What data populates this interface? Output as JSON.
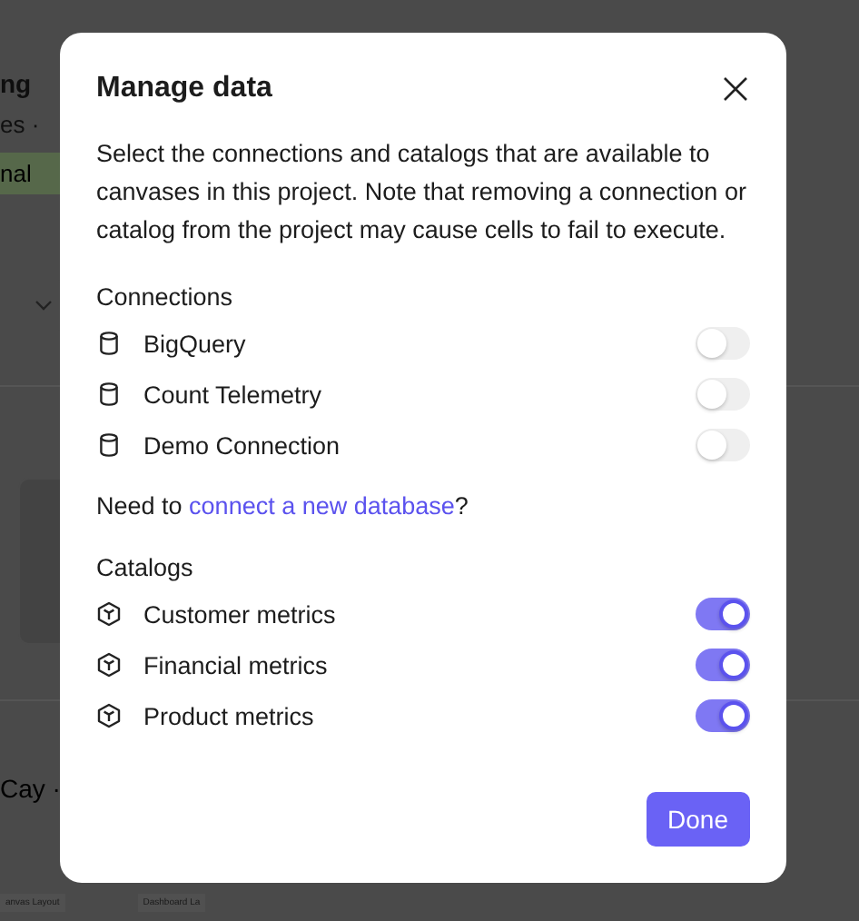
{
  "background": {
    "title": "ng",
    "subtitle": "es ·",
    "badge": "nal",
    "byline": "Cay ·",
    "thumbnails": [
      "anvas Layout",
      "Dashboard La"
    ]
  },
  "dialog": {
    "title": "Manage data",
    "description": "Select the connections and catalogs that are available to canvases in this project. Note that removing a connection or catalog from the project may cause cells to fail to execute.",
    "sections": [
      {
        "heading": "Connections",
        "kind": "connection",
        "items": [
          {
            "label": "BigQuery",
            "on": false
          },
          {
            "label": "Count Telemetry",
            "on": false
          },
          {
            "label": "Demo Connection",
            "on": false
          }
        ]
      },
      {
        "heading": "Catalogs",
        "kind": "catalog",
        "items": [
          {
            "label": "Customer metrics",
            "on": true
          },
          {
            "label": "Financial metrics",
            "on": true
          },
          {
            "label": "Product metrics",
            "on": true
          }
        ]
      }
    ],
    "link_prefix": "Need to ",
    "link": "connect a new database",
    "link_suffix": "?",
    "button": "Done"
  }
}
